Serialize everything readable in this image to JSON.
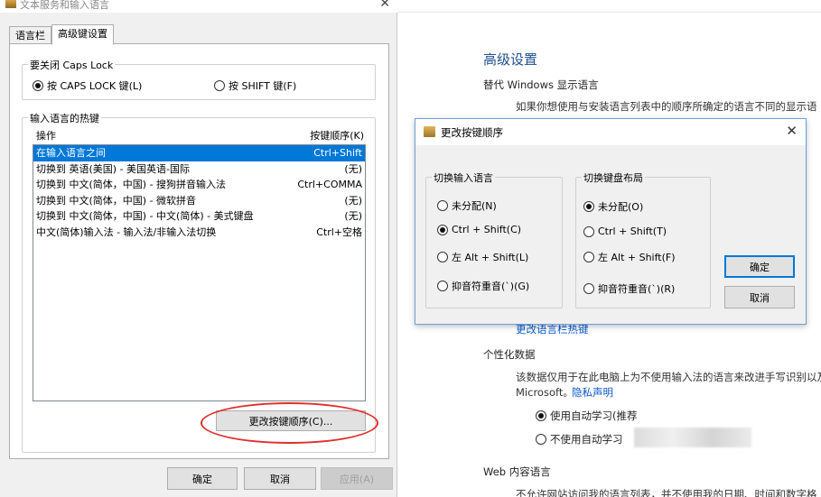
{
  "bg": {
    "title": "高级设置",
    "override_label": "替代 Windows 显示语言",
    "override_desc": "如果你想使用与安装语言列表中的顺序所确定的语言不同的显示语",
    "hotkey_link": "更改语言栏热键",
    "personal_label": "个性化数据",
    "personal_desc": "该数据仅用于在此电脑上为不使用输入法的语言来改进手写识别以及",
    "microsoft_text": "Microsoft。",
    "privacy_link": "隐私声明",
    "radio1": "使用自动学习(推荐",
    "radio2": "不使用自动学习",
    "web_label": "Web 内容语言",
    "web_desc": "不允许网站访问我的语言列表，并不使用我的日期、时间和数字格"
  },
  "left_dialog": {
    "title": "文本服务和输入语言",
    "tabs": [
      {
        "label": "语言栏"
      },
      {
        "label": "高级键设置"
      }
    ],
    "capslock": {
      "group_label": "要关闭 Caps Lock",
      "option1": "按 CAPS LOCK 键(L)",
      "option2": "按 SHIFT 键(F)"
    },
    "hotkeys": {
      "group_label": "输入语言的热键",
      "col_action": "操作",
      "col_key": "按键顺序(K)",
      "rows": [
        {
          "action": "在输入语言之间",
          "key": "Ctrl+Shift"
        },
        {
          "action": "切换到 英语(美国) - 美国英语-国际",
          "key": "(无)"
        },
        {
          "action": "切换到 中文(简体，中国) - 搜狗拼音输入法",
          "key": "Ctrl+COMMA"
        },
        {
          "action": "切换到 中文(简体，中国) - 微软拼音",
          "key": "(无)"
        },
        {
          "action": "切换到 中文(简体，中国) - 中文(简体) - 美式键盘",
          "key": "(无)"
        },
        {
          "action": "中文(简体)输入法 - 输入法/非输入法切换",
          "key": "Ctrl+空格"
        }
      ]
    },
    "change_seq_button": "更改按键顺序(C)...",
    "ok": "确定",
    "cancel": "取消",
    "apply": "应用(A)"
  },
  "front_dialog": {
    "title": "更改按键顺序",
    "input_group": {
      "label": "切换输入语言",
      "options": [
        "未分配(N)",
        "Ctrl + Shift(C)",
        "左 Alt + Shift(L)",
        "抑音符重音(`)(G)"
      ]
    },
    "layout_group": {
      "label": "切换键盘布局",
      "options": [
        "未分配(O)",
        "Ctrl + Shift(T)",
        "左 Alt + Shift(F)",
        "抑音符重音(`)(R)"
      ]
    },
    "ok": "确定",
    "cancel": "取消"
  }
}
